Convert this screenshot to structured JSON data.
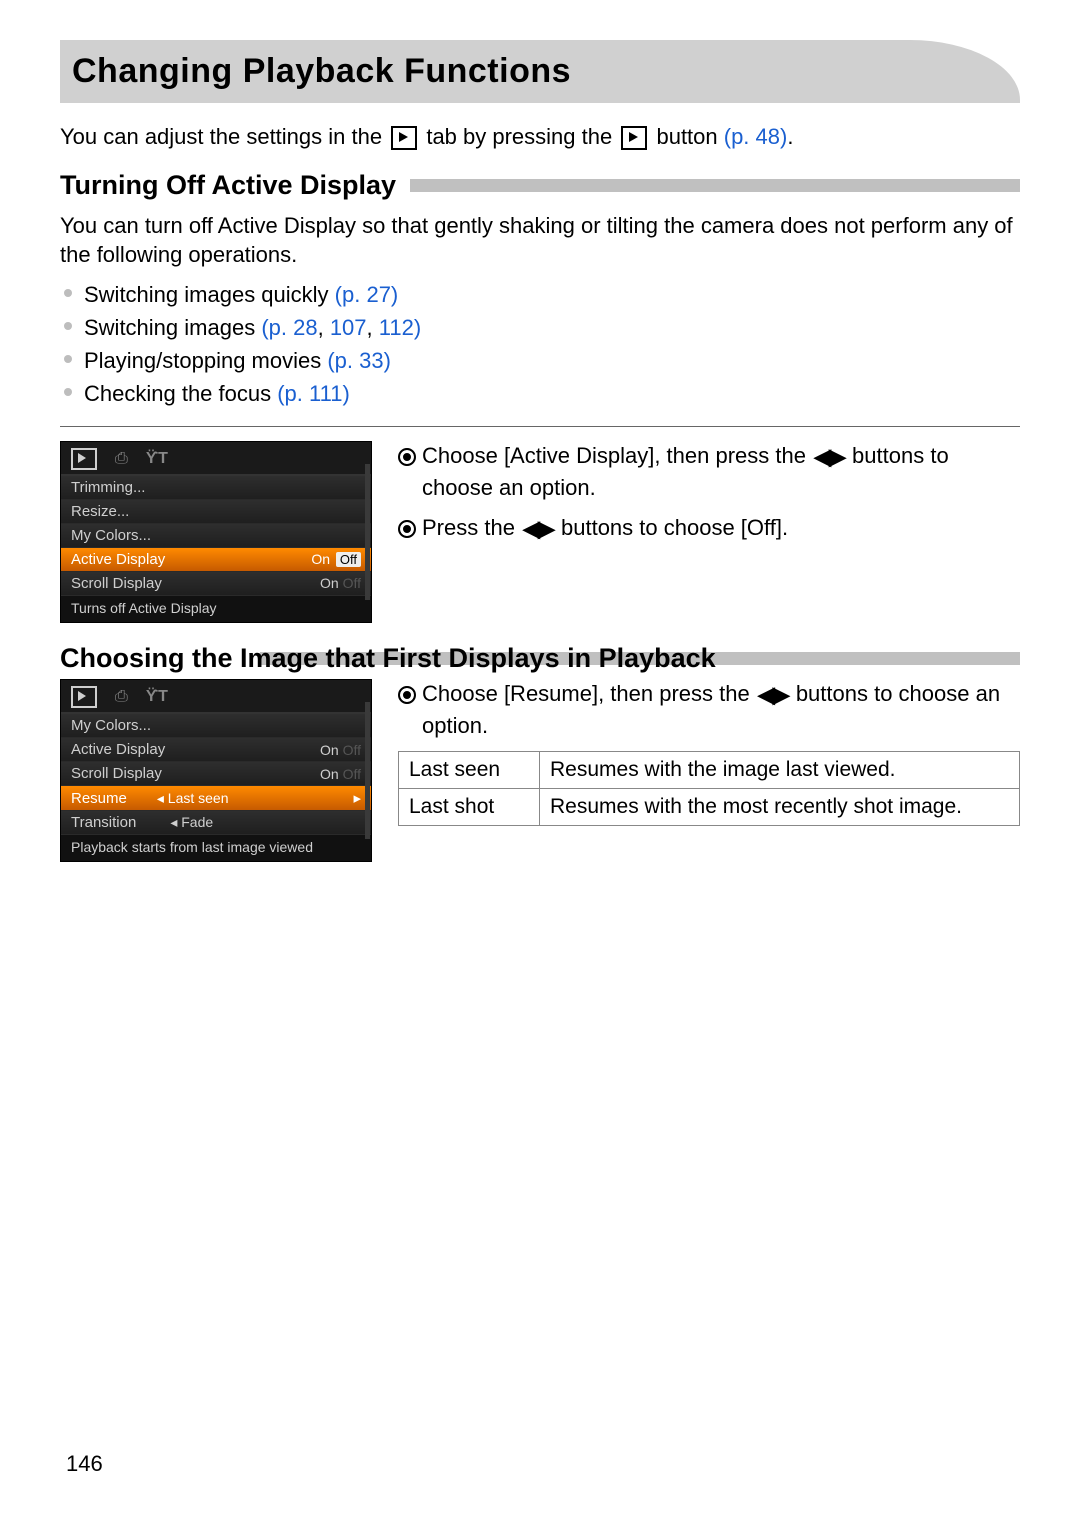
{
  "title": "Changing Playback Functions",
  "intro": {
    "pre": "You can adjust the settings in the ",
    "mid": " tab by pressing the ",
    "post": " button ",
    "ref": "(p. 48)",
    "period": "."
  },
  "section1": {
    "heading": "Turning Off Active Display",
    "para": "You can turn off Active Display so that gently shaking or tilting the camera does not perform any of the following operations.",
    "bullets": [
      {
        "text": "Switching images quickly ",
        "refs": [
          "(p. 27)"
        ]
      },
      {
        "text": "Switching images ",
        "refs": [
          "(p. 28",
          "107",
          "112)"
        ]
      },
      {
        "text": "Playing/stopping movies ",
        "refs": [
          "(p. 33)"
        ]
      },
      {
        "text": "Checking the focus ",
        "refs": [
          "(p. 111)"
        ]
      }
    ],
    "menu": {
      "rows": [
        {
          "label": "Trimming...",
          "value": ""
        },
        {
          "label": "Resize...",
          "value": ""
        },
        {
          "label": "My Colors...",
          "value": ""
        },
        {
          "label": "Active Display",
          "value_on": "On",
          "value_off": "Off",
          "selected": true
        },
        {
          "label": "Scroll Display",
          "value_on": "On",
          "value_dim": "Off"
        }
      ],
      "footer": "Turns off Active Display"
    },
    "steps": [
      "Choose [Active Display], then press the ◀▶ buttons to choose an option.",
      "Press the ◀▶ buttons to choose [Off]."
    ]
  },
  "section2": {
    "heading": "Choosing the Image that First Displays in Playback",
    "menu": {
      "rows": [
        {
          "label": "My Colors...",
          "value": ""
        },
        {
          "label": "Active Display",
          "value_on": "On",
          "value_dim": "Off"
        },
        {
          "label": "Scroll Display",
          "value_on": "On",
          "value_dim": "Off"
        },
        {
          "label": "Resume",
          "value_center": "Last seen",
          "selected": true,
          "arrows": true
        },
        {
          "label": "Transition",
          "value_center": "Fade",
          "arrows_left": true
        }
      ],
      "footer": "Playback starts from last image viewed"
    },
    "step": "Choose [Resume], then press the ◀▶ buttons to choose an option.",
    "table": [
      {
        "k": "Last seen",
        "v": "Resumes with the image last viewed."
      },
      {
        "k": "Last shot",
        "v": "Resumes with the most recently shot image."
      }
    ]
  },
  "page_number": "146"
}
